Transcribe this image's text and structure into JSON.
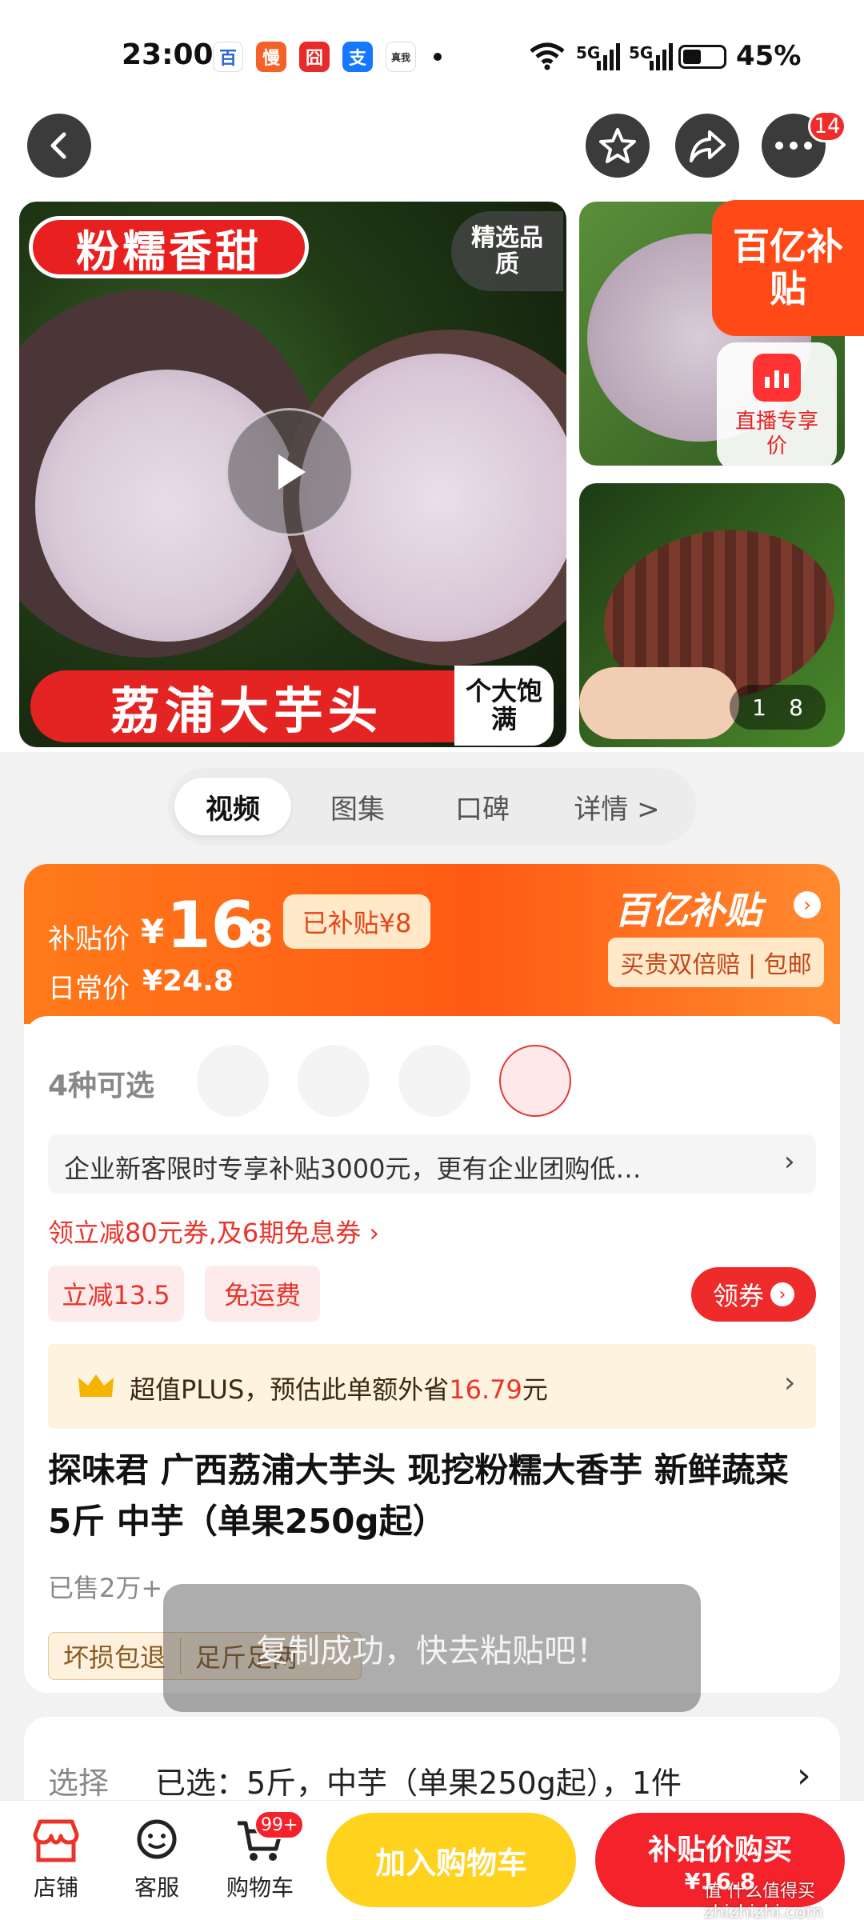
{
  "status_bar": {
    "time": "23:00",
    "network1": "5G",
    "network2": "5G",
    "battery": "45%",
    "app_icons": [
      "百",
      "慢",
      "囧",
      "支",
      "真我"
    ]
  },
  "nav": {
    "badge_count": "14"
  },
  "gallery": {
    "main_banner_top": "粉糯香甜",
    "main_tag": "精选品质",
    "main_banner_bottom": "荔浦大芋头",
    "main_side_tag": "个大饱满",
    "subsidy_logo": "百亿补贴",
    "live_label": "直播专享价",
    "counter_current": "1",
    "counter_total": "8"
  },
  "tabs": [
    "视频",
    "图集",
    "口碑",
    "详情 >"
  ],
  "price": {
    "label": "补贴价",
    "currency": "¥",
    "amount_int": "16",
    "amount_dec": ".8",
    "subsidized": "已补贴¥8",
    "regular_label": "日常价",
    "regular_price": "¥24.8",
    "brand": "百亿补贴",
    "guarantee": "买贵双倍赔 | 包邮"
  },
  "options": {
    "count_label": "4种可选"
  },
  "enterprise": {
    "text": "企业新客限时专享补贴3000元，更有企业团购低…"
  },
  "coupon": {
    "text": "领立减80元券,及6期免息券 ›",
    "chip1": "立减13.5",
    "chip2": "免运费",
    "claim_button": "领券"
  },
  "plus": {
    "text_prefix": "超值PLUS，预估此单额外省",
    "amount": "16.79",
    "unit": "元"
  },
  "product": {
    "title": "探味君 广西荔浦大芋头 现挖粉糯大香芋 新鲜蔬菜 5斤 中芋（单果250g起）",
    "sold": "已售2万+",
    "tag1": "坏损包退",
    "tag2": "足斤足两"
  },
  "toast": {
    "text": "复制成功，快去粘贴吧！"
  },
  "select": {
    "label": "选择",
    "value": "已选：5斤，中芋（单果250g起），1件"
  },
  "bottom": {
    "store": "店铺",
    "service": "客服",
    "cart": "购物车",
    "cart_badge": "99+",
    "add_cart": "加入购物车",
    "buy_title": "补贴价购买",
    "buy_price": "¥16.8"
  },
  "watermark": "值 什么值得买 zhizhizhi.com",
  "colors": {
    "accent": "#ff5a14",
    "red": "#f4222b",
    "yellow": "#ffd21e"
  }
}
